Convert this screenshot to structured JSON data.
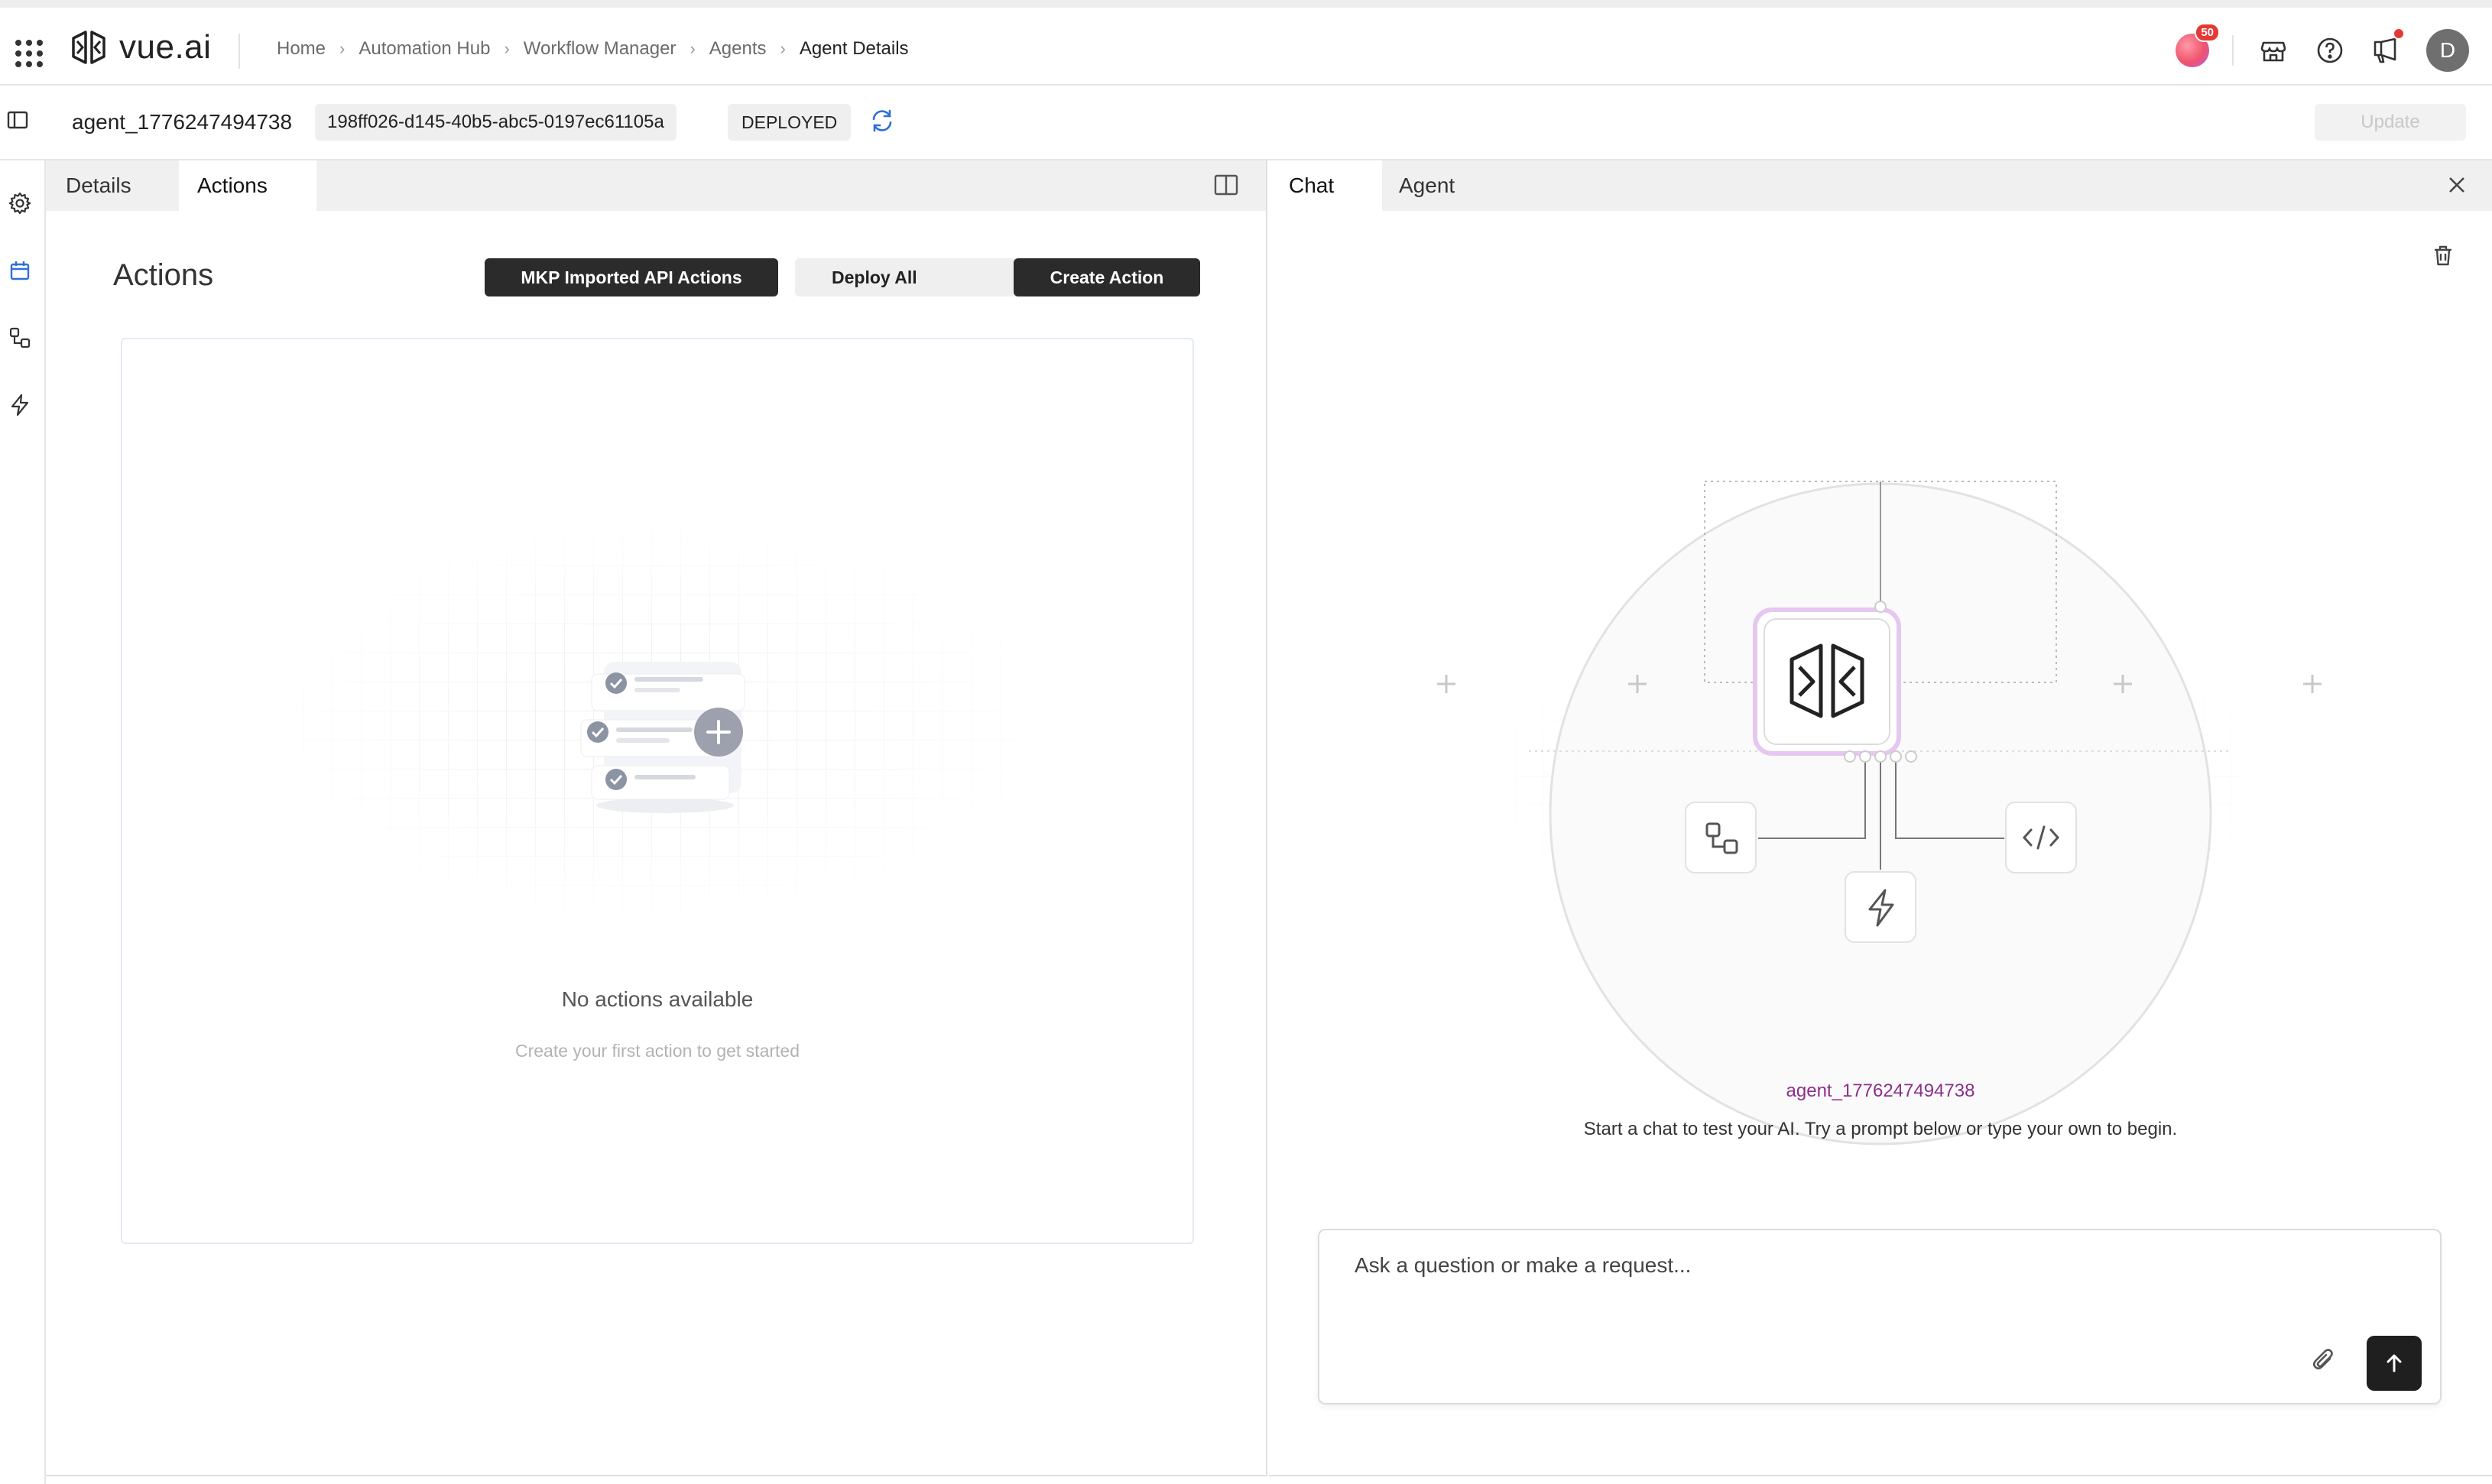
{
  "app": {
    "logo_text": "vue.ai"
  },
  "breadcrumb": [
    {
      "label": "Home"
    },
    {
      "label": "Automation Hub"
    },
    {
      "label": "Workflow Manager"
    },
    {
      "label": "Agents"
    },
    {
      "label": "Agent Details"
    }
  ],
  "header": {
    "credits_count": "50",
    "avatar_initial": "D",
    "notification_dot_color": "#e53935"
  },
  "agent": {
    "name": "agent_1776247494738",
    "id": "198ff026-d145-40b5-abc5-0197ec61105a",
    "status": "DEPLOYED",
    "update_label": "Update"
  },
  "left_rail": {
    "items": [
      {
        "icon": "gear-icon"
      },
      {
        "icon": "calendar-icon",
        "active": true
      },
      {
        "icon": "workflow-icon"
      },
      {
        "icon": "lightning-icon"
      }
    ],
    "active_color": "#2f6fd6"
  },
  "left_panel": {
    "tabs": [
      {
        "label": "Details"
      },
      {
        "label": "Actions",
        "active": true
      }
    ],
    "title": "Actions",
    "mkp_button": "MKP Imported API Actions",
    "deploy_all": "Deploy All",
    "create_action": "Create Action",
    "empty_title": "No actions available",
    "empty_subtitle": "Create your first action to get started"
  },
  "right_panel": {
    "tabs": [
      {
        "label": "Chat",
        "active": true
      },
      {
        "label": "Agent"
      }
    ],
    "agent_label": "agent_1776247494738",
    "hint": "Start a chat to test your AI. Try a prompt below or type your own to begin.",
    "input_placeholder": "Ask a question or make a request...",
    "accent_color": "#8b2f8b"
  }
}
